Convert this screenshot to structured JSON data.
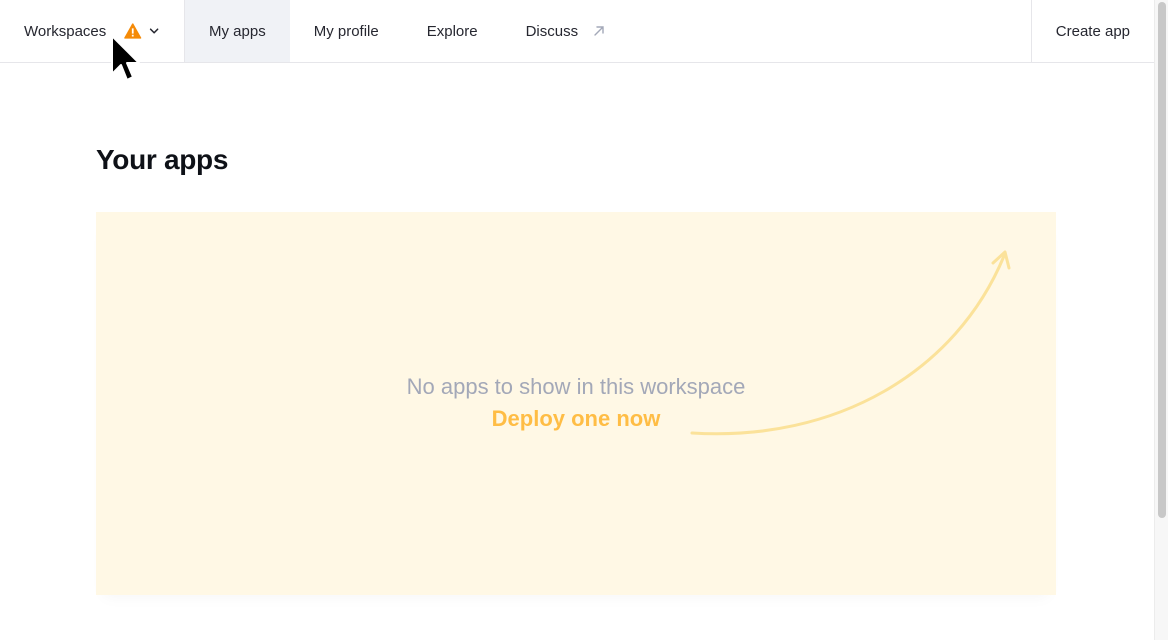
{
  "nav": {
    "workspaces_label": "Workspaces",
    "tabs": [
      {
        "label": "My apps",
        "active": true
      },
      {
        "label": "My profile",
        "active": false
      },
      {
        "label": "Explore",
        "active": false
      },
      {
        "label": "Discuss",
        "active": false,
        "external": true
      }
    ],
    "create_app_label": "Create app"
  },
  "main": {
    "title": "Your apps",
    "empty_message": "No apps to show in this workspace",
    "deploy_link": "Deploy one now"
  },
  "icons": {
    "warning": "warning-icon",
    "chevron": "chevron-down-icon",
    "external": "external-link-icon",
    "arrow": "curved-arrow-icon"
  },
  "colors": {
    "warning": "#f58a07",
    "active_tab_bg": "#f0f2f6",
    "card_bg": "#fff8e5",
    "accent": "#ffbd45",
    "muted_text": "#a3a8b8"
  }
}
